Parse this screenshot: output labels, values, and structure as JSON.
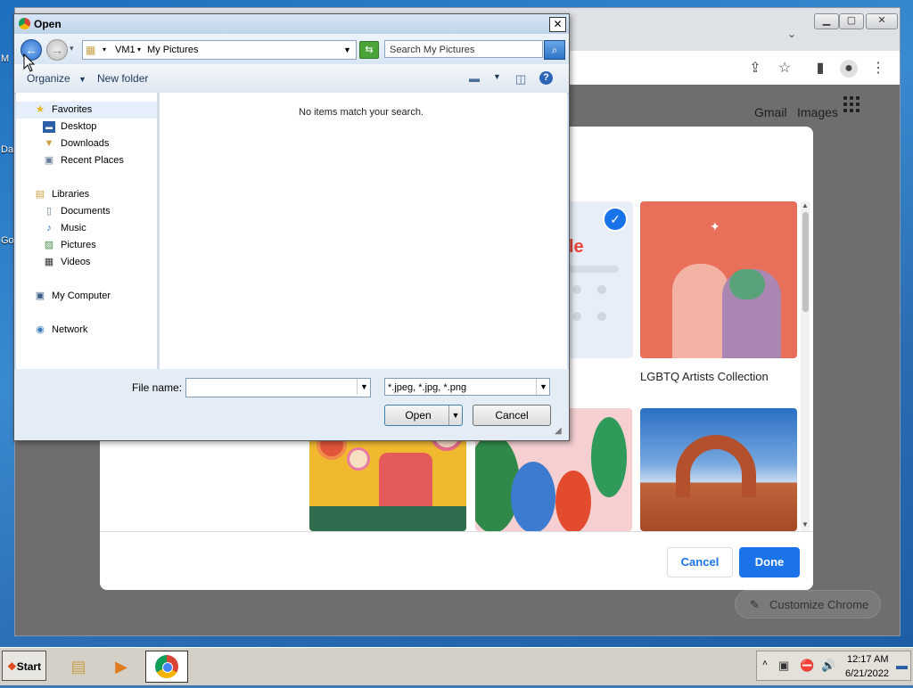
{
  "desktop": {
    "labels": [
      "M",
      "Da",
      "Go"
    ]
  },
  "chrome": {
    "toolbar_icons": [
      "share-icon",
      "star-icon",
      "sidepanel-icon",
      "profile-icon",
      "menu-icon"
    ],
    "ntp": {
      "gmail": "Gmail",
      "images": "Images",
      "customize_label": "Customize Chrome",
      "modal": {
        "tile_label": "LGBTQ Artists Collection",
        "classic_fragment": "le",
        "cancel": "Cancel",
        "done": "Done"
      }
    }
  },
  "dialog": {
    "title": "Open",
    "close": "✕",
    "address": {
      "root": "VM1",
      "folder": "My Pictures"
    },
    "search_placeholder": "Search My Pictures",
    "commands": {
      "organize": "Organize",
      "new_folder": "New folder"
    },
    "nav": {
      "favorites": "Favorites",
      "desktop": "Desktop",
      "downloads": "Downloads",
      "recent_places": "Recent Places",
      "libraries": "Libraries",
      "documents": "Documents",
      "music": "Music",
      "pictures": "Pictures",
      "videos": "Videos",
      "my_computer": "My Computer",
      "network": "Network"
    },
    "empty_message": "No items match your search.",
    "file_name_label": "File name:",
    "file_name_value": "",
    "file_type": "*.jpeg, *.jpg, *.png",
    "open": "Open",
    "cancel": "Cancel"
  },
  "taskbar": {
    "start": "Start",
    "time": "12:17 AM",
    "date": "6/21/2022"
  }
}
